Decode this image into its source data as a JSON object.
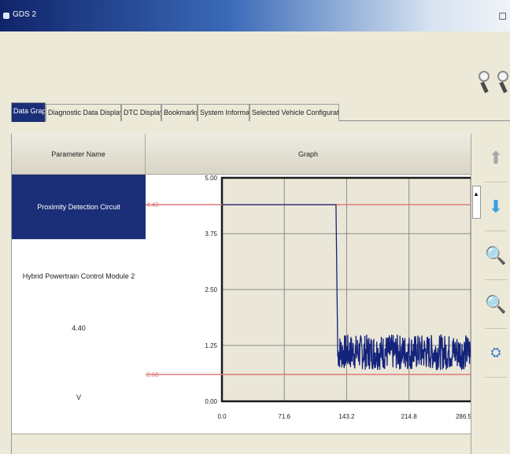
{
  "window": {
    "title": "GDS 2"
  },
  "tabs": [
    {
      "label": "Data Graph",
      "active": true
    },
    {
      "label": "Diagnostic Data Display",
      "active": false
    },
    {
      "label": "DTC Display",
      "active": false
    },
    {
      "label": "Bookmarks",
      "active": false
    },
    {
      "label": "System Information",
      "active": false
    },
    {
      "label": "Selected Vehicle Configuration",
      "active": false
    }
  ],
  "table": {
    "parameter_header": "Parameter Name",
    "graph_header": "Graph",
    "selected_parameter": "Proximity Detection Circuit",
    "module": "Hybrid Powertrain Control Module 2",
    "value": "4.40",
    "unit": "V"
  },
  "chart_data": {
    "type": "line",
    "x_ticks": [
      "0.0",
      "71.6",
      "143.2",
      "214.8",
      "286.5"
    ],
    "y_ticks": [
      "0.00",
      "1.25",
      "2.50",
      "3.75",
      "5.00"
    ],
    "xlim": [
      0,
      286.5
    ],
    "ylim": [
      0,
      5
    ],
    "thresholds": [
      {
        "label": "4.40",
        "value": 4.4,
        "color": "#e07a7a"
      },
      {
        "label": "0.60",
        "value": 0.6,
        "color": "#e07a7a"
      }
    ],
    "series": [
      {
        "color": "#14237a",
        "x": [
          0,
          2,
          131,
          133,
          286.5
        ],
        "y": [
          4.4,
          4.4,
          4.4,
          1.0,
          1.1
        ],
        "noisy_after_x": 133,
        "noise_range": [
          0.7,
          1.5
        ]
      }
    ],
    "grid": true
  },
  "colors": {
    "accent": "#1b2f78",
    "threshold": "#e07a7a",
    "signal": "#14237a"
  },
  "sidebar_icons": [
    "up-arrow-icon",
    "down-arrow-icon",
    "zoom-in-icon",
    "zoom-out-icon",
    "binoculars-icon"
  ]
}
